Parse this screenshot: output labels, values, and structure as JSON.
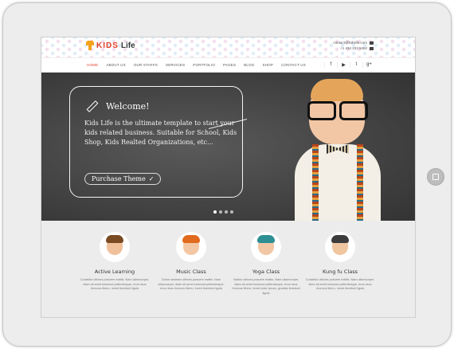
{
  "site": {
    "logo_kids": "KIDS",
    "logo_life": "Life",
    "contact_email": "contact@kidslife.com",
    "contact_phone": "+1 434 222 5462"
  },
  "nav": {
    "items": [
      "HOME",
      "ABOUT US",
      "OUR STAFFS",
      "SERVICES",
      "PORTFOLIO",
      "PAGES",
      "BLOG",
      "SHOP",
      "CONTACT US"
    ],
    "active_index": 0
  },
  "social": {
    "items": [
      {
        "icon": "facebook-icon",
        "glyph": "f"
      },
      {
        "icon": "youtube-icon",
        "glyph": "▶"
      },
      {
        "icon": "twitter-icon",
        "glyph": "t"
      },
      {
        "icon": "google-plus-icon",
        "glyph": "g+"
      }
    ]
  },
  "hero": {
    "welcome": "Welcome!",
    "text": "Kids Life is the ultimate template to start your kids related business. Suitable for School, Kids Shop, Kids Realted Organizations, etc...",
    "purchase_label": "Purchase Theme",
    "purchase_check": "✓",
    "slider_dots": 4,
    "active_dot": 0
  },
  "classes": [
    {
      "title": "Active Learning",
      "desc": "Curabitur ultrices posuere mattis. Nam ullamcorper, diam sit amet euismod pellentesque, eros risus rhoncus libero, inved tincidunt ligula",
      "face": "#f0c09a",
      "hair": "#7a4a22"
    },
    {
      "title": "Music Class",
      "desc": "Donor sedeser ultrices posuere mattis. Nam ullamcorper, diam sit amet euismod pellentesque, eros risus rhoncus libero, inved tincidunt ligula",
      "face": "#f4c7a4",
      "hair": "#e06a1d"
    },
    {
      "title": "Yoga Class",
      "desc": "Naldur ultrices posuere mattis. Nam ullamcorper, diam sit amet euismod pellentesque, eros risus rhoncus libero, inved dolor ipsum, gravida tincidunt ligula",
      "face": "#f2c7a6",
      "hair": "#2d8f93"
    },
    {
      "title": "Kung fu Class",
      "desc": "Curabitur ultrices posuere mattis. Nam ullamcorper, diam sit amet euismod pellentesque, eros risus rhoncus libero, inved tincidunt ligula",
      "face": "#f0c6a0",
      "hair": "#3c3c3c"
    }
  ],
  "colors": {
    "accent": "#e2402a",
    "chalkboard": "#444444",
    "frame": "#ededed"
  }
}
